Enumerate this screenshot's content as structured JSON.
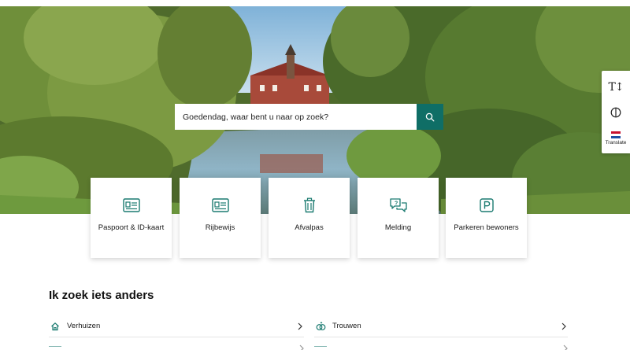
{
  "search": {
    "placeholder": "Goedendag, waar bent u naar op zoek?",
    "icon": "search-icon"
  },
  "toolbar": {
    "text_size_glyph": "T↕",
    "translate_label": "Translate"
  },
  "cards": [
    {
      "label": "Paspoort & ID-kaart",
      "icon": "id-card-icon"
    },
    {
      "label": "Rijbewijs",
      "icon": "license-icon"
    },
    {
      "label": "Afvalpas",
      "icon": "trash-icon"
    },
    {
      "label": "Melding",
      "icon": "chat-icon"
    },
    {
      "label": "Parkeren bewoners",
      "icon": "parking-icon"
    }
  ],
  "section": {
    "title": "Ik zoek iets anders",
    "links": [
      {
        "label": "Verhuizen",
        "icon": "house-icon"
      },
      {
        "label": "Trouwen",
        "icon": "rings-icon"
      }
    ]
  },
  "colors": {
    "accent": "#0f6e66",
    "icon": "#1a7a70"
  }
}
